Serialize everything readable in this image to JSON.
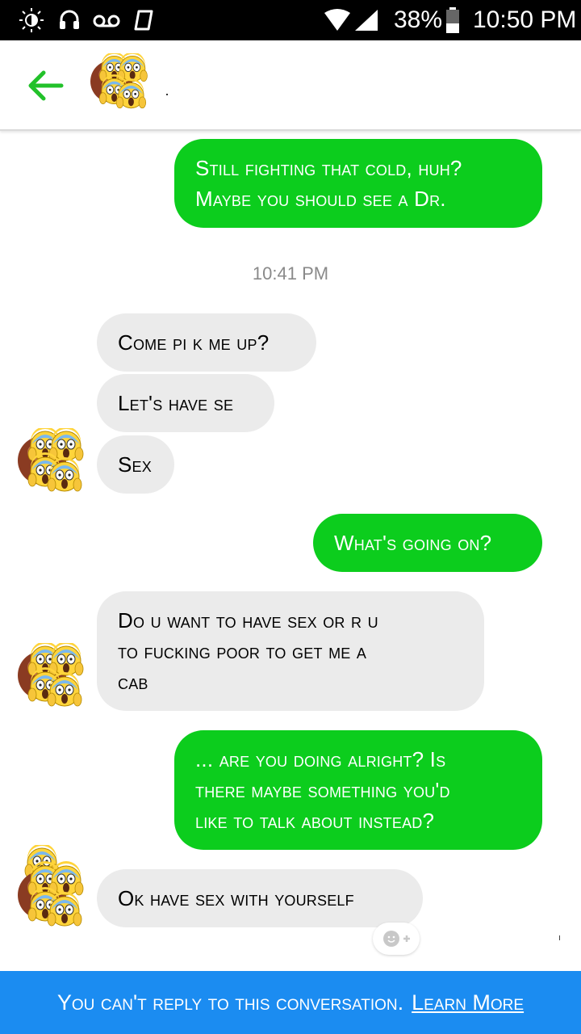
{
  "status_bar": {
    "battery": "38%",
    "time": "10:50 PM",
    "icons": [
      "brightness-icon",
      "headset-icon",
      "voicemail-icon",
      "notification-icon",
      "wifi-icon",
      "signal-icon",
      "battery-icon"
    ]
  },
  "header": {
    "back_icon": "back-arrow-icon",
    "contact_avatar": "screaming-emoji-avatar",
    "accent": "#22c12a"
  },
  "messages": [
    {
      "dir": "out",
      "lines": [
        "Still fighting that cold, huh?",
        "Maybe you should see a Dr."
      ]
    },
    {
      "dir": "in",
      "lines": [
        "Come pi k me up?"
      ]
    },
    {
      "dir": "in",
      "lines": [
        "Let's have se"
      ]
    },
    {
      "dir": "in",
      "lines": [
        "Sex"
      ]
    },
    {
      "dir": "out",
      "lines": [
        "What's going on?"
      ]
    },
    {
      "dir": "in",
      "lines": [
        "Do u want to have sex or r u",
        "to fucking poor to get me a",
        "cab"
      ]
    },
    {
      "dir": "out",
      "lines": [
        "... are you doing alright? Is",
        "there maybe something you'd",
        "like to talk about instead?"
      ]
    },
    {
      "dir": "in",
      "lines": [
        "Ok have sex with yourself"
      ]
    }
  ],
  "timestamp": "10:41 PM",
  "reaction_button": "add-reaction-icon",
  "footer": {
    "notice": "You can't reply to this conversation.",
    "link": "Learn More"
  },
  "colors": {
    "outgoing_bubble": "#0ccd1d",
    "incoming_bubble": "#ebebeb",
    "footer_bg": "#1b8cf1"
  }
}
